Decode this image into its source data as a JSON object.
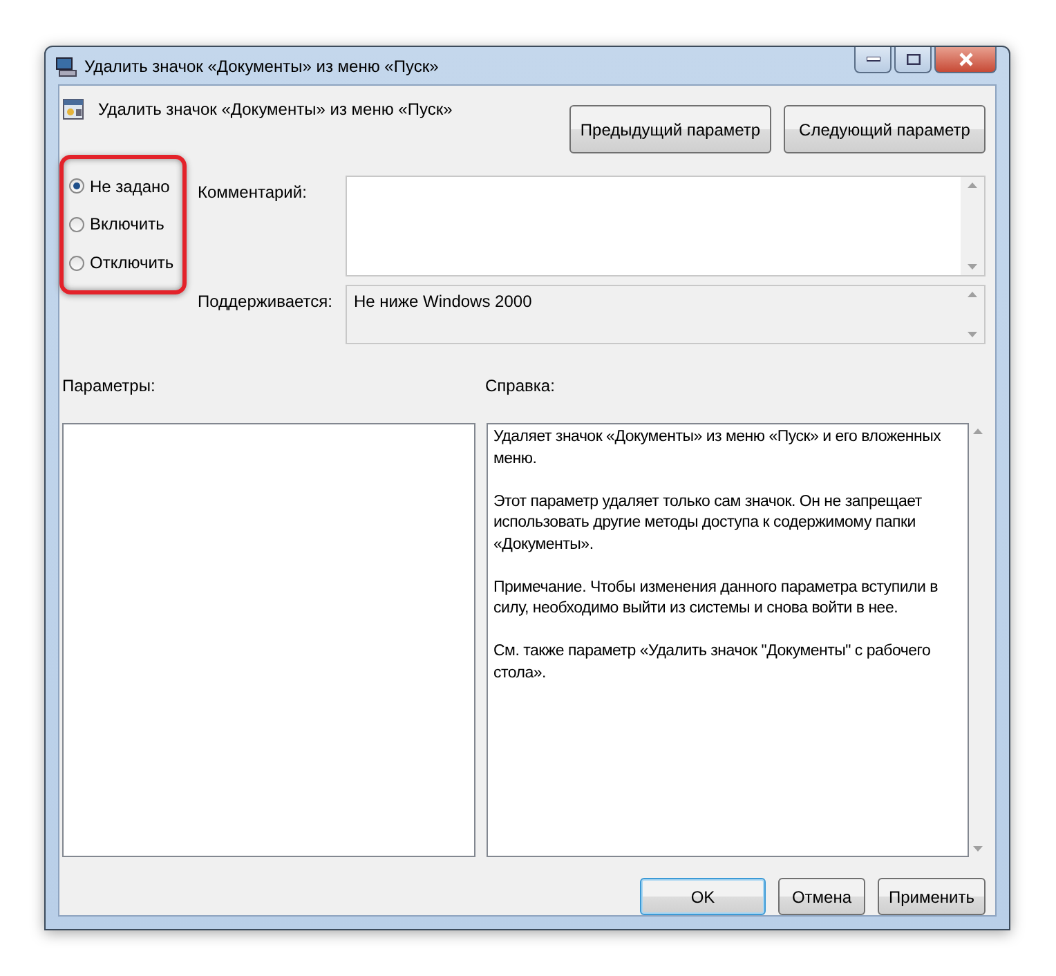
{
  "window": {
    "title": "Удалить значок «Документы» из меню «Пуск»"
  },
  "policy": {
    "title": "Удалить значок «Документы» из меню «Пуск»"
  },
  "nav_buttons": [
    "Предыдущий параметр",
    "Следующий параметр"
  ],
  "options": [
    {
      "label": "Не задано",
      "selected": true
    },
    {
      "label": "Включить",
      "selected": false
    },
    {
      "label": "Отключить",
      "selected": false
    }
  ],
  "comment": {
    "label": "Комментарий:"
  },
  "supported": {
    "label": "Поддерживается:",
    "value": "Не ниже Windows 2000"
  },
  "parameters": {
    "label": "Параметры:"
  },
  "help": {
    "label": "Справка:",
    "paragraphs": [
      "Удаляет значок «Документы» из меню «Пуск» и его вложенных меню.",
      "Этот параметр удаляет только сам значок. Он не запрещает использовать другие методы доступа к содержимому папки «Документы».",
      "Примечание. Чтобы изменения данного параметра вступили в силу, необходимо выйти из системы и снова войти в нее.",
      "См. также параметр «Удалить значок \"Документы\" с рабочего стола»."
    ]
  },
  "buttons": [
    {
      "label": "OK",
      "default": true
    },
    {
      "label": "Отмена",
      "default": false
    },
    {
      "label": "Применить",
      "default": false
    }
  ]
}
